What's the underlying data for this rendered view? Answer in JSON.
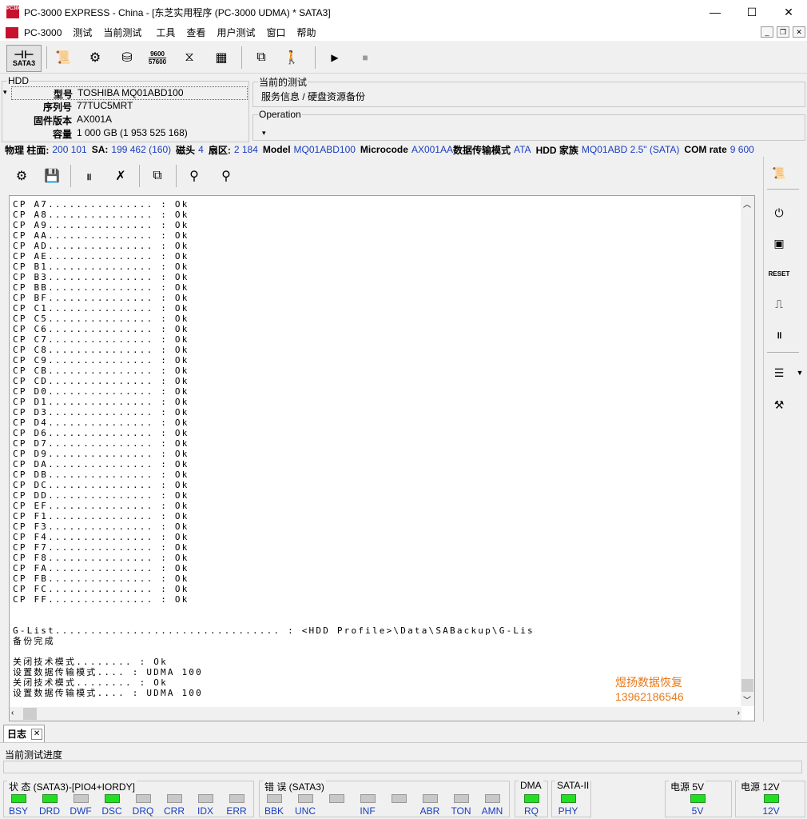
{
  "window": {
    "title": "PC-3000 EXPRESS - China - [东芝实用程序 (PC-3000 UDMA) * SATA3]",
    "logo_text": "PC3000",
    "minimize": "—",
    "maximize": "☐",
    "close": "✕"
  },
  "menu": {
    "items": [
      "PC-3000",
      "测试",
      "当前测试",
      "工具",
      "查看",
      "用户测试",
      "窗口",
      "帮助"
    ],
    "mdi_min": "_",
    "mdi_restore": "❐",
    "mdi_close": "✕"
  },
  "toolbar": {
    "sata_label": "SATA3",
    "baud_top": "9600",
    "baud_bottom": "57600"
  },
  "hdd": {
    "group_title": "HDD",
    "rows": [
      {
        "label": "型号",
        "value": "TOSHIBA MQ01ABD100"
      },
      {
        "label": "序列号",
        "value": "77TUC5MRT"
      },
      {
        "label": "固件版本",
        "value": "AX001A"
      },
      {
        "label": "容量",
        "value": "1 000 GB (1 953 525 168)"
      }
    ]
  },
  "current_test": {
    "group_title": "当前的测试",
    "value": "服务信息 / 硬盘资源备份"
  },
  "operation": {
    "group_title": "Operation",
    "value": "▾"
  },
  "phys": {
    "label_phys": "物理 柱面:",
    "cyl": "200 101",
    "label_sa": "SA:",
    "sa": "199 462 (160)",
    "label_heads": "磁头",
    "heads": "4",
    "label_zones": "扇区:",
    "zones": "2 184",
    "label_model": "Model",
    "model": "MQ01ABD100",
    "label_microcode": "Microcode",
    "microcode": "AX001AA",
    "label_mode": "数据传输模式",
    "mode": "ATA",
    "label_family": "HDD 家族",
    "family": "MQ01ABD 2.5\" (SATA)",
    "label_com": "COM rate",
    "com": "9 600"
  },
  "log": {
    "lines": [
      "CP A7............... : Ok",
      "CP A8............... : Ok",
      "CP A9............... : Ok",
      "CP AA............... : Ok",
      "CP AD............... : Ok",
      "CP AE............... : Ok",
      "CP B1............... : Ok",
      "CP B3............... : Ok",
      "CP BB............... : Ok",
      "CP BF............... : Ok",
      "CP C1............... : Ok",
      "CP C5............... : Ok",
      "CP C6............... : Ok",
      "CP C7............... : Ok",
      "CP C8............... : Ok",
      "CP C9............... : Ok",
      "CP CB............... : Ok",
      "CP CD............... : Ok",
      "CP D0............... : Ok",
      "CP D1............... : Ok",
      "CP D3............... : Ok",
      "CP D4............... : Ok",
      "CP D6............... : Ok",
      "CP D7............... : Ok",
      "CP D9............... : Ok",
      "CP DA............... : Ok",
      "CP DB............... : Ok",
      "CP DC............... : Ok",
      "CP DD............... : Ok",
      "CP EF............... : Ok",
      "CP F1............... : Ok",
      "CP F3............... : Ok",
      "CP F4............... : Ok",
      "CP F7............... : Ok",
      "CP F8............... : Ok",
      "CP FA............... : Ok",
      "CP FB............... : Ok",
      "CP FC............... : Ok",
      "CP FF............... : Ok",
      "",
      "",
      "G-List................................ : <HDD Profile>\\Data\\SABackup\\G-Lis",
      "备份完成",
      "",
      "关闭技术模式........ : Ok",
      "设置数据传输模式.... : UDMA 100",
      "关闭技术模式........ : Ok",
      "设置数据传输模式.... : UDMA 100"
    ]
  },
  "watermark": {
    "line1": "煜扬数据恢复",
    "line2": "13962186546"
  },
  "tabs": {
    "log_tab": "日志",
    "close": "✕"
  },
  "progress": {
    "label": "当前测试进度",
    "fraction": 0
  },
  "status": {
    "state_group": "状 态 (SATA3)-[PIO4+IORDY]",
    "state_leds": [
      {
        "name": "BSY",
        "on": true
      },
      {
        "name": "DRD",
        "on": true
      },
      {
        "name": "DWF",
        "on": false
      },
      {
        "name": "DSC",
        "on": true
      },
      {
        "name": "DRQ",
        "on": false
      },
      {
        "name": "CRR",
        "on": false
      },
      {
        "name": "IDX",
        "on": false
      },
      {
        "name": "ERR",
        "on": false
      }
    ],
    "error_group": "错 误 (SATA3)",
    "error_leds": [
      {
        "name": "BBK",
        "on": false
      },
      {
        "name": "UNC",
        "on": false
      },
      {
        "name": "",
        "on": false
      },
      {
        "name": "INF",
        "on": false
      },
      {
        "name": "",
        "on": false
      },
      {
        "name": "ABR",
        "on": false
      },
      {
        "name": "TON",
        "on": false
      },
      {
        "name": "AMN",
        "on": false
      }
    ],
    "dma_group": "DMA",
    "dma_led": {
      "name": "RQ",
      "on": true
    },
    "sata_group": "SATA-II",
    "sata_led": {
      "name": "PHY",
      "on": true
    },
    "p5_group": "电源 5V",
    "p5_led": {
      "name": "5V",
      "on": true
    },
    "p12_group": "电源 12V",
    "p12_led": {
      "name": "12V",
      "on": true
    },
    "colors": {
      "on": "#21e021",
      "off": "#c8c8c8"
    }
  }
}
